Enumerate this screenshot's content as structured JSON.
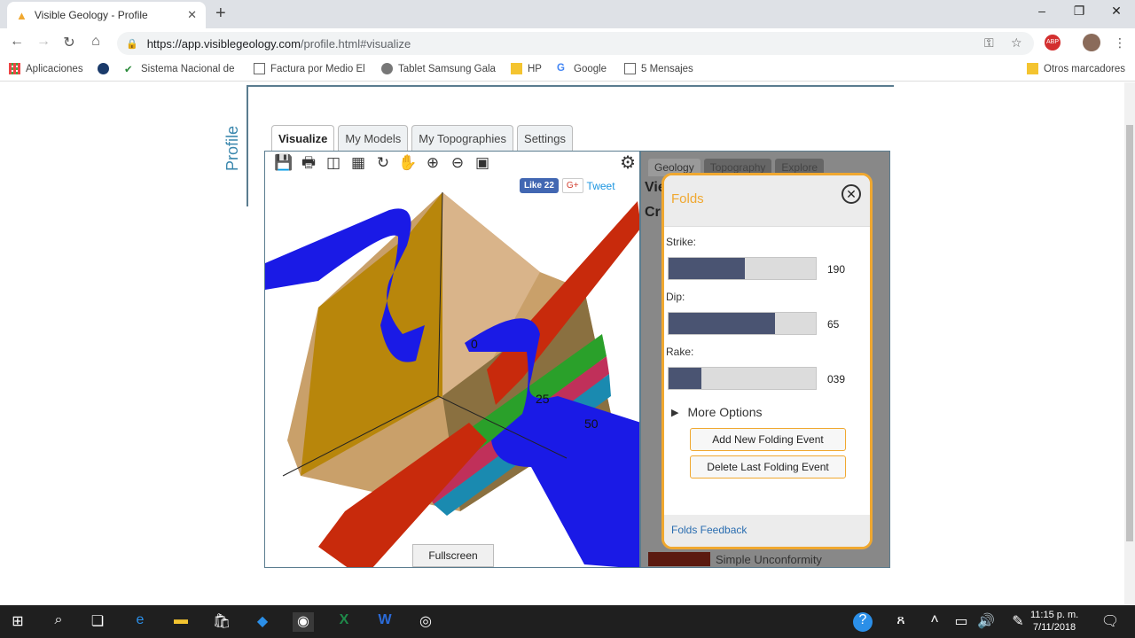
{
  "browser": {
    "tab_title": "Visible Geology - Profile",
    "url_host": "https://app.visiblegeology.com",
    "url_path": "/profile.html#visualize"
  },
  "bookmarks": [
    {
      "label": "Aplicaciones"
    },
    {
      "label": "Sistema Nacional de"
    },
    {
      "label": "Factura por Medio El"
    },
    {
      "label": "Tablet Samsung Gala"
    },
    {
      "label": "HP"
    },
    {
      "label": "Google"
    },
    {
      "label": "5 Mensajes"
    },
    {
      "label": "Otros marcadores"
    }
  ],
  "page": {
    "section_label": "Profile",
    "tabs": [
      "Visualize",
      "My Models",
      "My Topographies",
      "Settings"
    ],
    "social": {
      "like": "Like 22",
      "gplus": "G+",
      "tweet": "Tweet"
    },
    "fullscreen_label": "Fullscreen",
    "axis_labels": [
      "0",
      "25",
      "50"
    ],
    "side_tabs": [
      "Geology",
      "Topography",
      "Explore"
    ],
    "side_heading_1": "Vie",
    "side_heading_2": "Cr",
    "side_bottom_label": "Simple Unconformity"
  },
  "folds": {
    "title": "Folds",
    "strike": {
      "label": "Strike:",
      "value": "190",
      "fraction": 0.52
    },
    "dip": {
      "label": "Dip:",
      "value": "65",
      "fraction": 0.72
    },
    "rake": {
      "label": "Rake:",
      "value": "039",
      "fraction": 0.22
    },
    "more_options": "More Options",
    "add_button": "Add New Folding Event",
    "delete_button": "Delete Last Folding Event",
    "feedback": "Folds Feedback"
  },
  "taskbar": {
    "time": "11:15 p. m.",
    "date": "7/11/2018"
  },
  "colors": {
    "accent_orange": "#f0a830",
    "fold_blue": "#1a1ae6",
    "fault_red": "#c82a0c",
    "layer_tan": "#d9b48a",
    "layer_gold": "#b8860b"
  }
}
